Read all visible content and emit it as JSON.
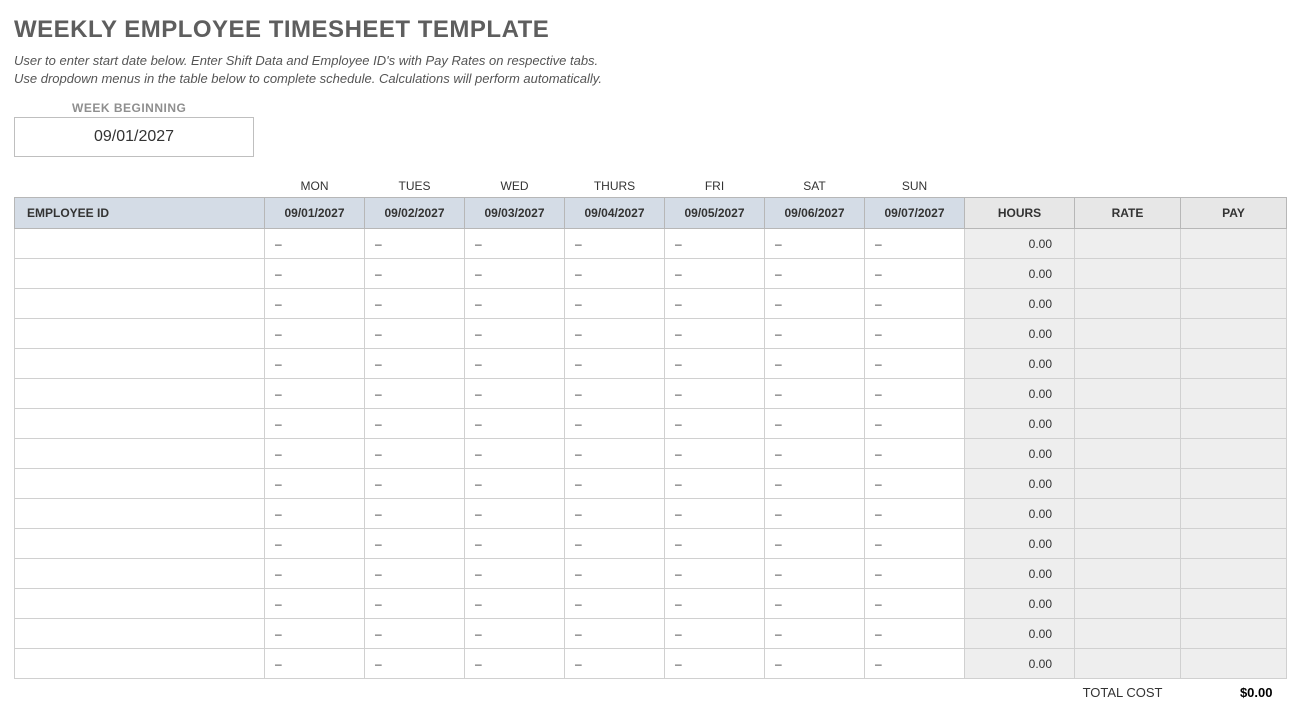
{
  "title": "WEEKLY EMPLOYEE TIMESHEET TEMPLATE",
  "instructions_line1": "User to enter start date below.  Enter Shift Data and Employee ID's with Pay Rates on respective tabs.",
  "instructions_line2": "Use dropdown menus in the table below to complete schedule. Calculations will perform automatically.",
  "week_label": "WEEK BEGINNING",
  "week_value": "09/01/2027",
  "days": [
    "MON",
    "TUES",
    "WED",
    "THURS",
    "FRI",
    "SAT",
    "SUN"
  ],
  "dates": [
    "09/01/2027",
    "09/02/2027",
    "09/03/2027",
    "09/04/2027",
    "09/05/2027",
    "09/06/2027",
    "09/07/2027"
  ],
  "headers": {
    "employee_id": "EMPLOYEE ID",
    "hours": "HOURS",
    "rate": "RATE",
    "pay": "PAY"
  },
  "rows": [
    {
      "emp": "",
      "d": [
        "–",
        "–",
        "–",
        "–",
        "–",
        "–",
        "–"
      ],
      "hours": "0.00",
      "rate": "",
      "pay": ""
    },
    {
      "emp": "",
      "d": [
        "–",
        "–",
        "–",
        "–",
        "–",
        "–",
        "–"
      ],
      "hours": "0.00",
      "rate": "",
      "pay": ""
    },
    {
      "emp": "",
      "d": [
        "–",
        "–",
        "–",
        "–",
        "–",
        "–",
        "–"
      ],
      "hours": "0.00",
      "rate": "",
      "pay": ""
    },
    {
      "emp": "",
      "d": [
        "–",
        "–",
        "–",
        "–",
        "–",
        "–",
        "–"
      ],
      "hours": "0.00",
      "rate": "",
      "pay": ""
    },
    {
      "emp": "",
      "d": [
        "–",
        "–",
        "–",
        "–",
        "–",
        "–",
        "–"
      ],
      "hours": "0.00",
      "rate": "",
      "pay": ""
    },
    {
      "emp": "",
      "d": [
        "–",
        "–",
        "–",
        "–",
        "–",
        "–",
        "–"
      ],
      "hours": "0.00",
      "rate": "",
      "pay": ""
    },
    {
      "emp": "",
      "d": [
        "–",
        "–",
        "–",
        "–",
        "–",
        "–",
        "–"
      ],
      "hours": "0.00",
      "rate": "",
      "pay": ""
    },
    {
      "emp": "",
      "d": [
        "–",
        "–",
        "–",
        "–",
        "–",
        "–",
        "–"
      ],
      "hours": "0.00",
      "rate": "",
      "pay": ""
    },
    {
      "emp": "",
      "d": [
        "–",
        "–",
        "–",
        "–",
        "–",
        "–",
        "–"
      ],
      "hours": "0.00",
      "rate": "",
      "pay": ""
    },
    {
      "emp": "",
      "d": [
        "–",
        "–",
        "–",
        "–",
        "–",
        "–",
        "–"
      ],
      "hours": "0.00",
      "rate": "",
      "pay": ""
    },
    {
      "emp": "",
      "d": [
        "–",
        "–",
        "–",
        "–",
        "–",
        "–",
        "–"
      ],
      "hours": "0.00",
      "rate": "",
      "pay": ""
    },
    {
      "emp": "",
      "d": [
        "–",
        "–",
        "–",
        "–",
        "–",
        "–",
        "–"
      ],
      "hours": "0.00",
      "rate": "",
      "pay": ""
    },
    {
      "emp": "",
      "d": [
        "–",
        "–",
        "–",
        "–",
        "–",
        "–",
        "–"
      ],
      "hours": "0.00",
      "rate": "",
      "pay": ""
    },
    {
      "emp": "",
      "d": [
        "–",
        "–",
        "–",
        "–",
        "–",
        "–",
        "–"
      ],
      "hours": "0.00",
      "rate": "",
      "pay": ""
    },
    {
      "emp": "",
      "d": [
        "–",
        "–",
        "–",
        "–",
        "–",
        "–",
        "–"
      ],
      "hours": "0.00",
      "rate": "",
      "pay": ""
    }
  ],
  "total_label": "TOTAL COST",
  "total_value": "$0.00"
}
